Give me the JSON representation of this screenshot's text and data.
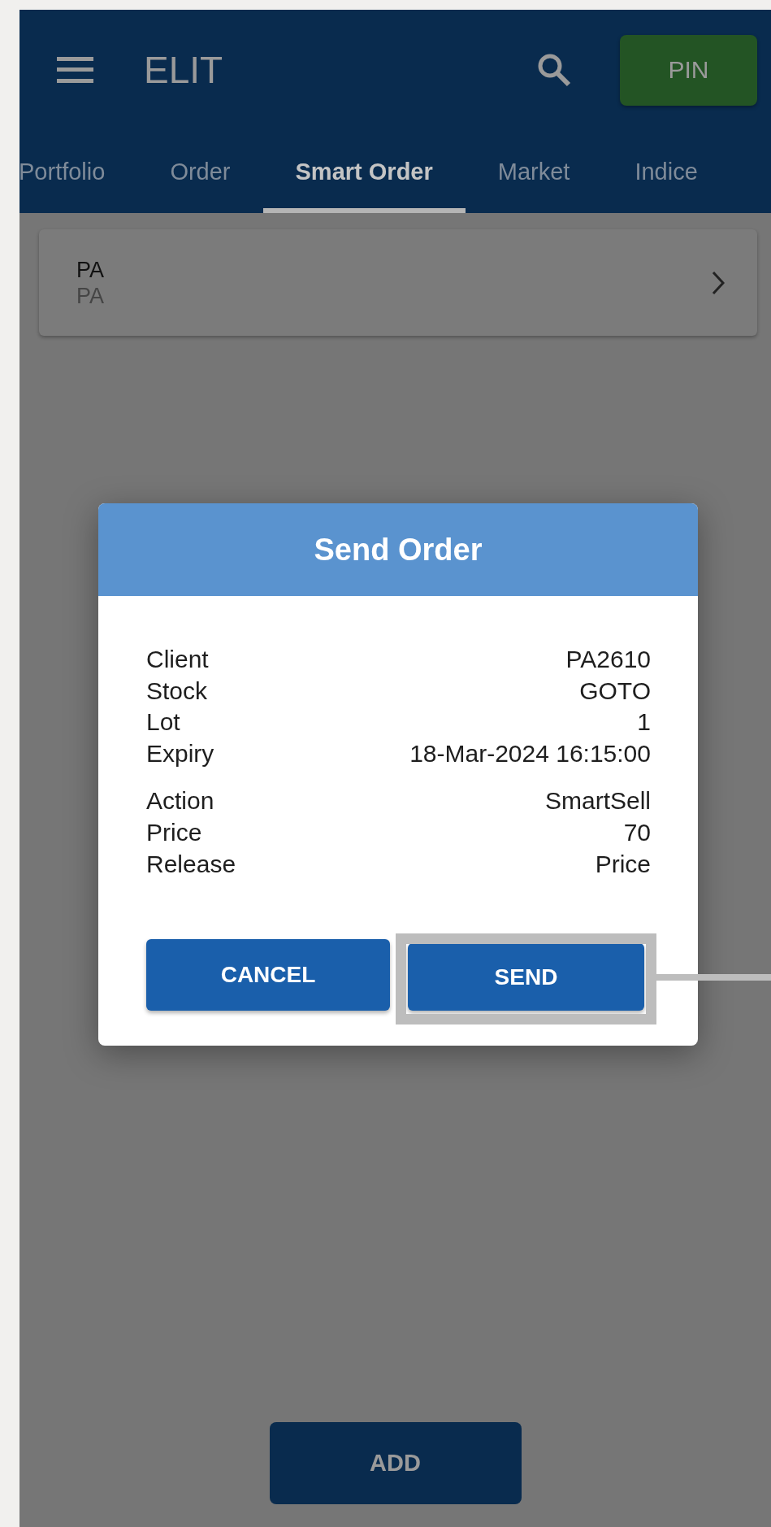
{
  "app_bar": {
    "title": "ELIT",
    "pin_button": "PIN"
  },
  "tabs": [
    {
      "label": "Portfolio",
      "selected": false
    },
    {
      "label": "Order",
      "selected": false
    },
    {
      "label": "Smart Order",
      "selected": true
    },
    {
      "label": "Market",
      "selected": false
    },
    {
      "label": "Indice",
      "selected": false
    }
  ],
  "card": {
    "line_1": "PA",
    "line_2": "PA"
  },
  "dialog": {
    "title": "Send Order",
    "groups": [
      [
        {
          "label": "Client",
          "value": "PA2610"
        },
        {
          "label": "Stock",
          "value": "GOTO"
        },
        {
          "label": "Lot",
          "value": "1"
        },
        {
          "label": "Expiry",
          "value": "18-Mar-2024 16:15:00"
        }
      ],
      [
        {
          "label": "Action",
          "value": "SmartSell"
        },
        {
          "label": "Price",
          "value": "70"
        },
        {
          "label": "Release",
          "value": "Price"
        }
      ]
    ],
    "buttons": [
      {
        "label": "CANCEL",
        "highlighted": false
      },
      {
        "label": "SEND",
        "highlighted": true
      }
    ]
  },
  "add_button": "ADD"
}
